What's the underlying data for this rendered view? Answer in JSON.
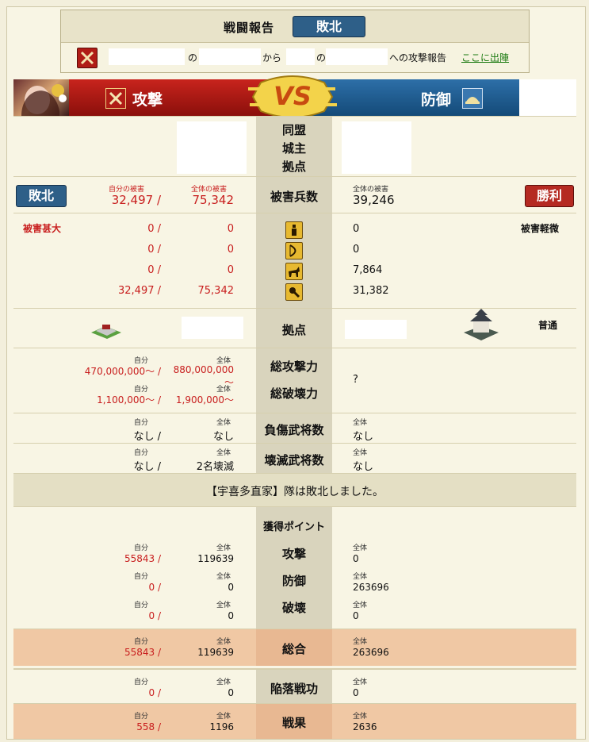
{
  "header": {
    "title": "戦闘報告",
    "result_badge": "敗北",
    "from_no": "の",
    "from_kara": "から",
    "to_no": "の",
    "report_suffix": "への攻撃報告",
    "sortie_link": "ここに出陣"
  },
  "vs": {
    "attack_label": "攻撃",
    "defense_label": "防御",
    "vs_text": "VS"
  },
  "info": {
    "alliance": "同盟",
    "lord": "城主",
    "base": "拠点"
  },
  "damage": {
    "attacker_result": "敗北",
    "defender_result": "勝利",
    "self_damage_label": "自分の被害",
    "total_damage_label": "全体の被害",
    "self_damage": "32,497 /",
    "total_damage": "75,342",
    "center_label": "被害兵数",
    "def_total_label": "全体の被害",
    "def_total": "39,246"
  },
  "troops": {
    "atk_status": "被害甚大",
    "def_status": "被害軽微",
    "rows": [
      {
        "self": "0 /",
        "total": "0",
        "def": "0",
        "icon": "infantry-icon"
      },
      {
        "self": "0 /",
        "total": "0",
        "def": "0",
        "icon": "archer-icon"
      },
      {
        "self": "0 /",
        "total": "0",
        "def": "7,864",
        "icon": "cavalry-icon"
      },
      {
        "self": "32,497 /",
        "total": "75,342",
        "def": "31,382",
        "icon": "siege-icon"
      }
    ]
  },
  "base": {
    "label": "拠点",
    "def_type": "普通"
  },
  "power": {
    "self_label": "自分",
    "total_label": "全体",
    "atk_self": "470,000,000～ /",
    "atk_total": "880,000,000～",
    "atk_label": "総攻撃力",
    "break_self": "1,100,000～ /",
    "break_total": "1,900,000～",
    "break_label": "総破壊力",
    "def_value": "?"
  },
  "injured": {
    "label": "負傷武将数",
    "self_label": "自分",
    "total_label": "全体",
    "self": "なし /",
    "total": "なし",
    "def_total_label": "全体",
    "def": "なし"
  },
  "destroyed": {
    "label": "壊滅武将数",
    "self_label": "自分",
    "total_label": "全体",
    "self": "なし /",
    "total": "2名壊滅",
    "def_total_label": "全体",
    "def": "なし"
  },
  "message": "【宇喜多直家】隊は敗北しました。",
  "points": {
    "title": "獲得ポイント",
    "self_label": "自分",
    "total_label": "全体",
    "rows": [
      {
        "label": "攻撃",
        "self": "55843 /",
        "total": "119639",
        "def": "0"
      },
      {
        "label": "防御",
        "self": "0 /",
        "total": "0",
        "def": "263696"
      },
      {
        "label": "破壊",
        "self": "0 /",
        "total": "0",
        "def": "0"
      }
    ],
    "sum": {
      "label": "総合",
      "self": "55843 /",
      "total": "119639",
      "def": "263696"
    },
    "fall": {
      "label": "陥落戦功",
      "self": "0 /",
      "total": "0",
      "def": "0"
    },
    "result": {
      "label": "戦果",
      "self": "558 /",
      "total": "1196",
      "def": "2636"
    }
  },
  "colors": {
    "attack_red": "#b52a22",
    "defense_blue": "#2e5f88",
    "highlight_orange": "#f0c8a4"
  }
}
